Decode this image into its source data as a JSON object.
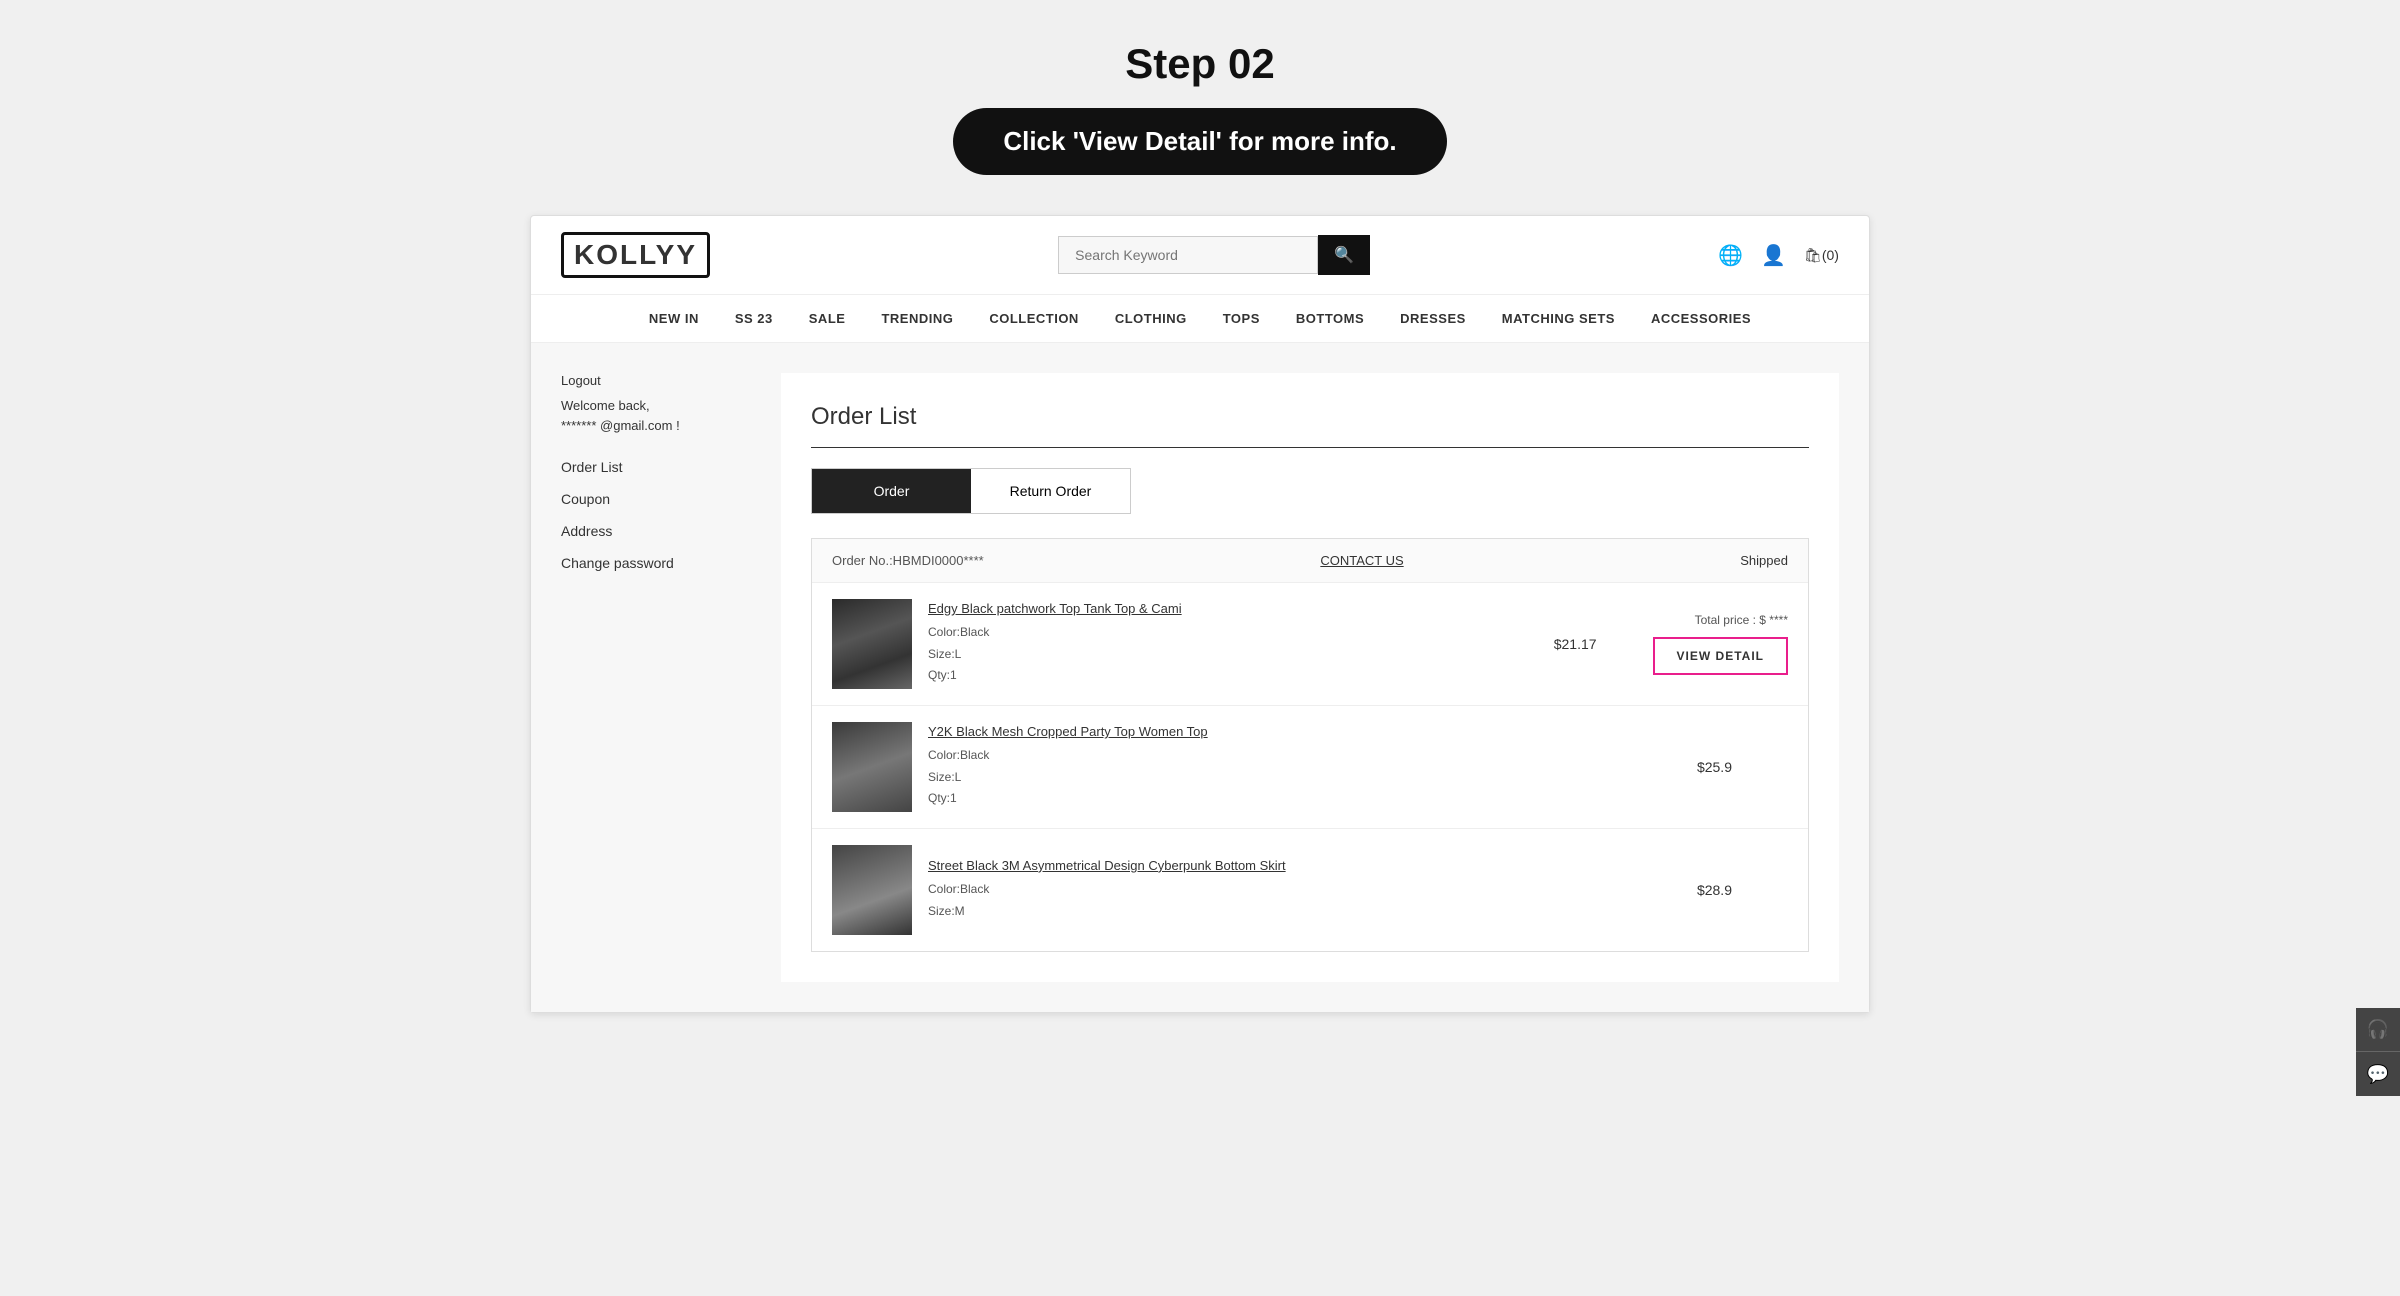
{
  "instruction": {
    "step_title": "Step 02",
    "button_label": "Click 'View Detail' for more info."
  },
  "header": {
    "logo_text": "KOLLYY",
    "search_placeholder": "Search Keyword",
    "cart_label": "(0)"
  },
  "nav": {
    "items": [
      {
        "label": "NEW IN"
      },
      {
        "label": "SS 23"
      },
      {
        "label": "SALE"
      },
      {
        "label": "TRENDING"
      },
      {
        "label": "COLLECTION"
      },
      {
        "label": "CLOTHING"
      },
      {
        "label": "TOPS"
      },
      {
        "label": "BOTTOMS"
      },
      {
        "label": "DRESSES"
      },
      {
        "label": "MATCHING SETS"
      },
      {
        "label": "ACCESSORIES"
      }
    ]
  },
  "sidebar": {
    "logout_label": "Logout",
    "welcome_label": "Welcome back,",
    "email_label": "******* @gmail.com !",
    "menu_items": [
      {
        "label": "Order List"
      },
      {
        "label": "Coupon"
      },
      {
        "label": "Address"
      },
      {
        "label": "Change password"
      }
    ]
  },
  "main": {
    "page_title": "Order List",
    "tabs": [
      {
        "label": "Order"
      },
      {
        "label": "Return Order"
      }
    ],
    "order_card": {
      "order_number": "Order No.:HBMDI0000****",
      "contact_us": "CONTACT US",
      "status": "Shipped",
      "items": [
        {
          "name": "Edgy Black patchwork Top Tank Top & Cami",
          "color": "Color:Black",
          "size": "Size:L",
          "qty": "Qty:1",
          "price": "$21.17",
          "total_price_label": "Total price : $ ****",
          "view_detail_label": "VIEW DETAIL"
        },
        {
          "name": "Y2K Black Mesh Cropped Party Top Women Top",
          "color": "Color:Black",
          "size": "Size:L",
          "qty": "Qty:1",
          "price": "$25.9",
          "total_price_label": "",
          "view_detail_label": ""
        },
        {
          "name": "Street Black 3M Asymmetrical Design Cyberpunk Bottom Skirt",
          "color": "Color:Black",
          "size": "Size:M",
          "qty": "",
          "price": "$28.9",
          "total_price_label": "",
          "view_detail_label": ""
        }
      ]
    }
  }
}
